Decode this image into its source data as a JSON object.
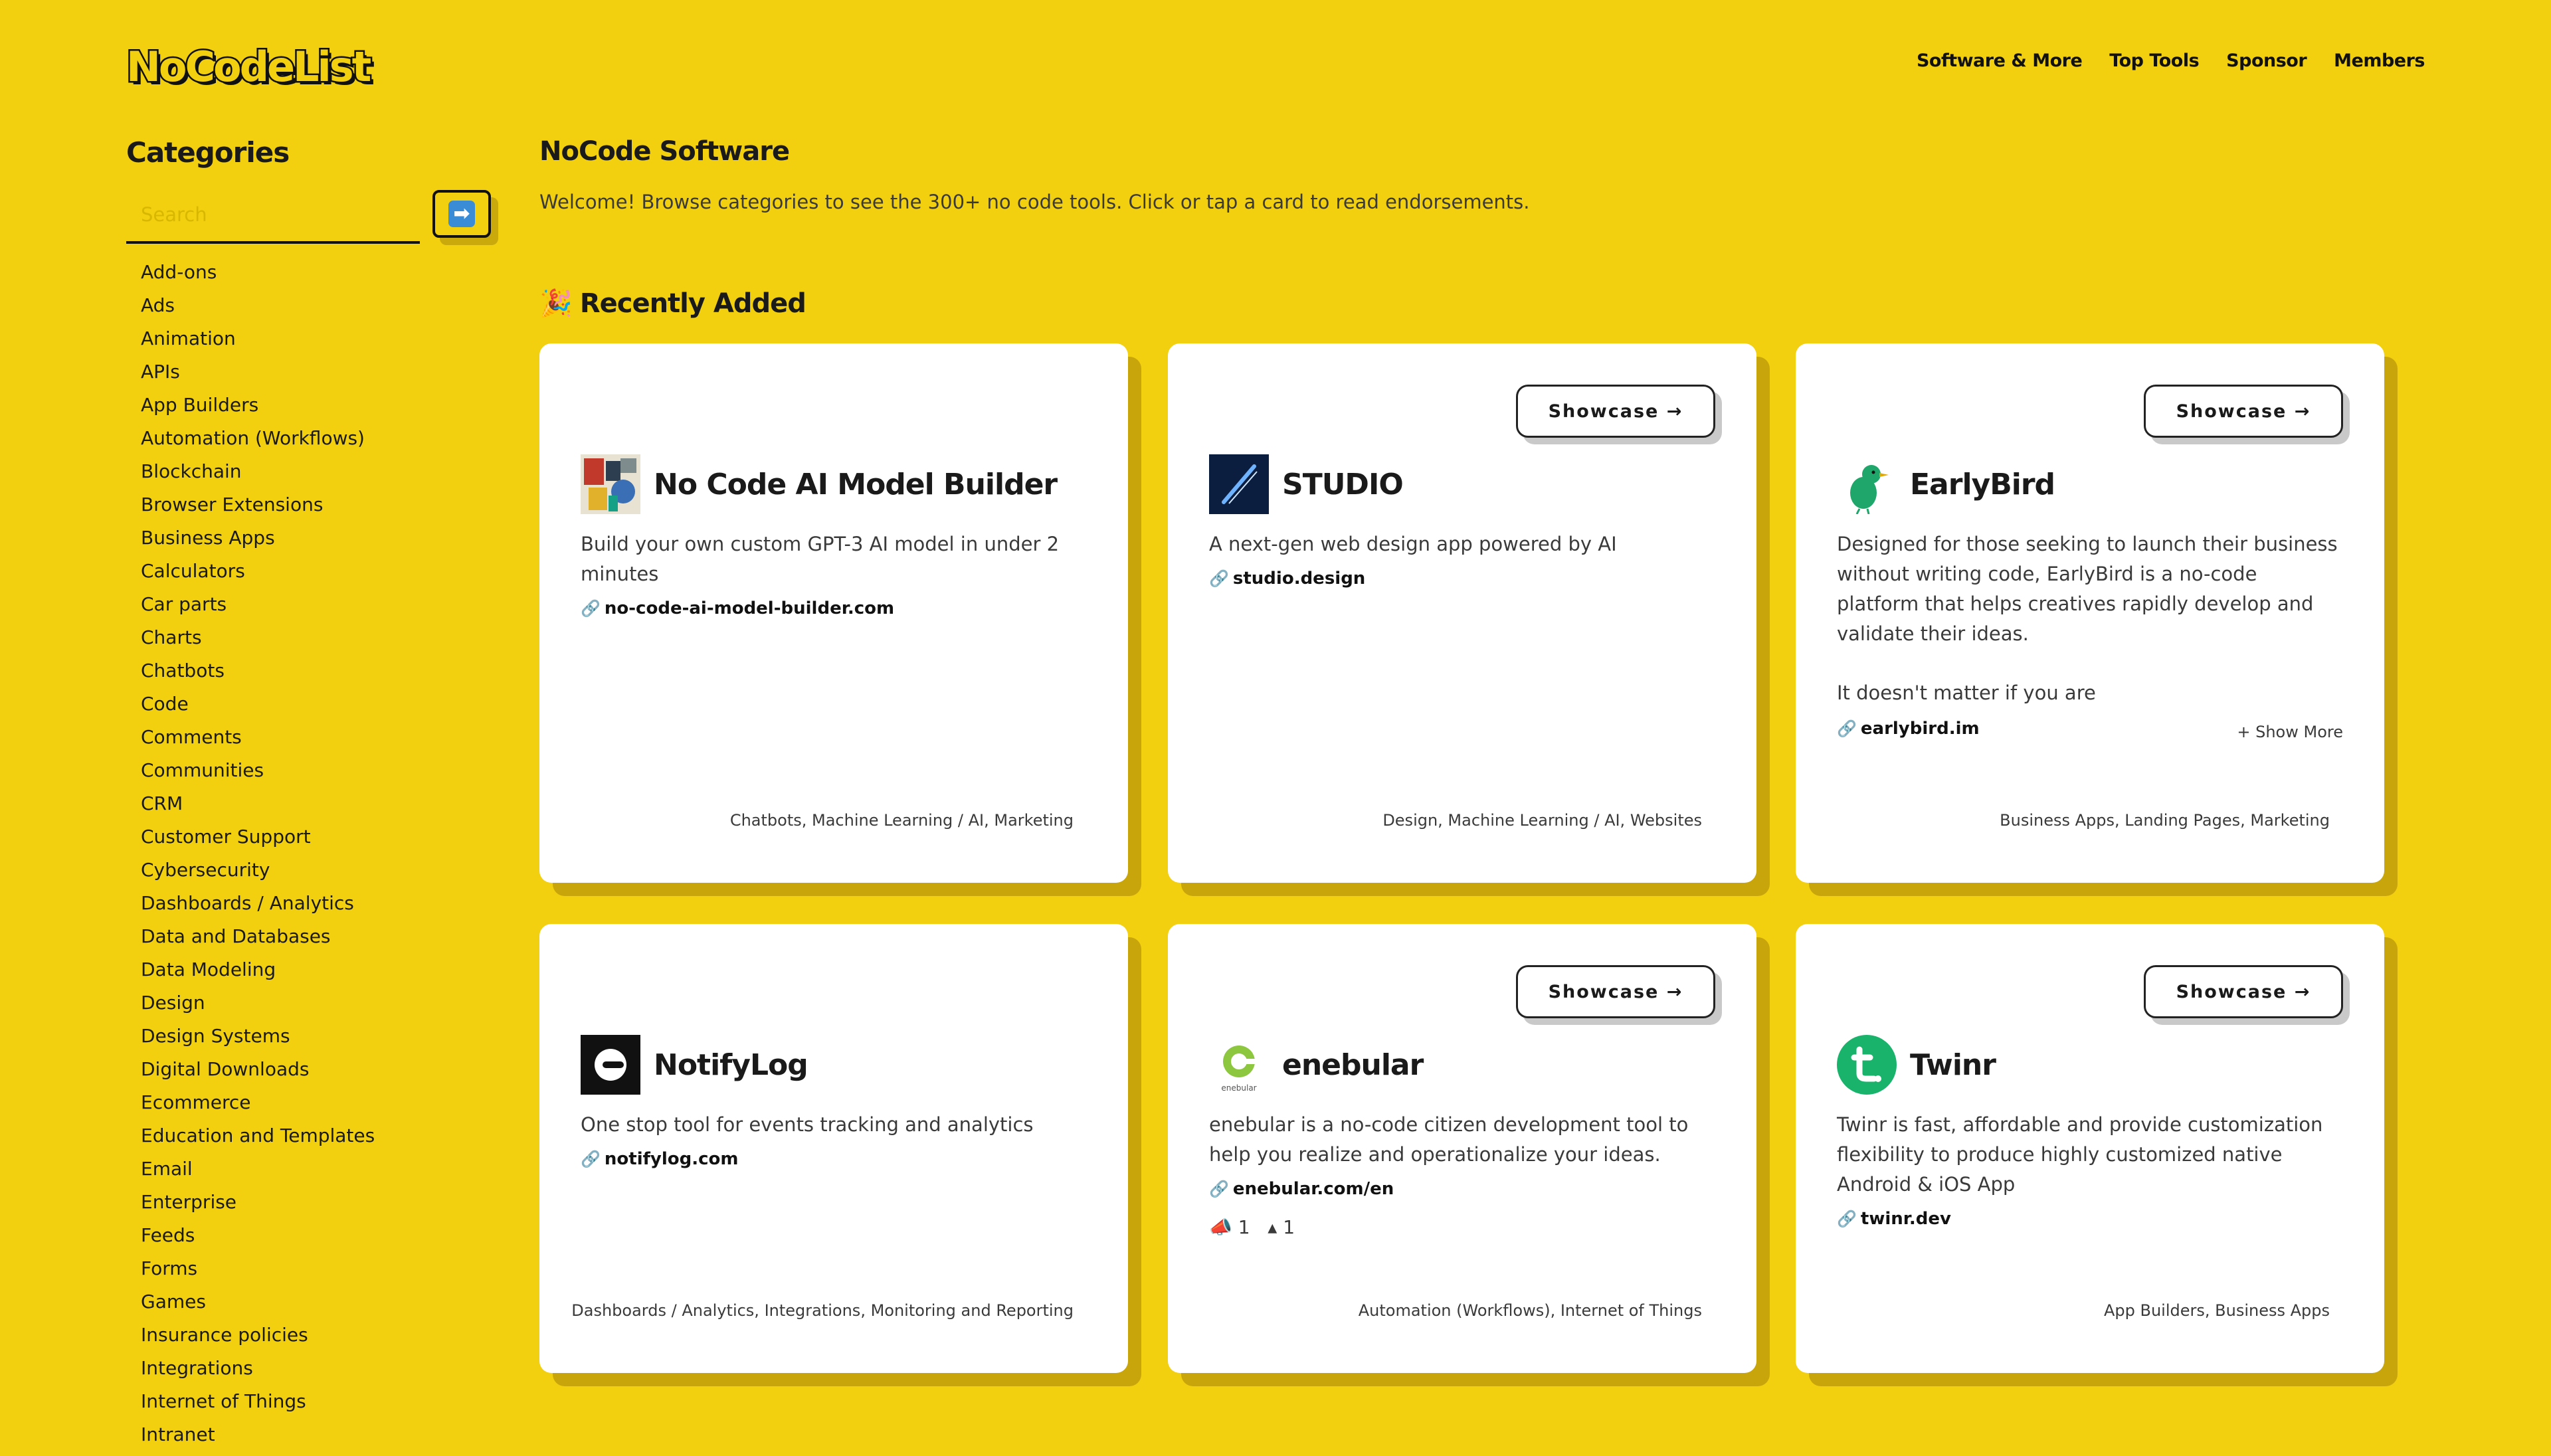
{
  "brand": {
    "logo_text": "NoCodeList"
  },
  "nav": [
    "Software & More",
    "Top Tools",
    "Sponsor",
    "Members"
  ],
  "sidebar": {
    "title": "Categories",
    "search_placeholder": "Search",
    "categories": [
      "Add-ons",
      "Ads",
      "Animation",
      "APIs",
      "App Builders",
      "Automation (Workflows)",
      "Blockchain",
      "Browser Extensions",
      "Business Apps",
      "Calculators",
      "Car parts",
      "Charts",
      "Chatbots",
      "Code",
      "Comments",
      "Communities",
      "CRM",
      "Customer Support",
      "Cybersecurity",
      "Dashboards / Analytics",
      "Data and Databases",
      "Data Modeling",
      "Design",
      "Design Systems",
      "Digital Downloads",
      "Ecommerce",
      "Education and Templates",
      "Email",
      "Enterprise",
      "Feeds",
      "Forms",
      "Games",
      "Insurance policies",
      "Integrations",
      "Internet of Things",
      "Intranet"
    ]
  },
  "main": {
    "title": "NoCode Software",
    "subtitle": "Welcome! Browse categories to see the 300+ no code tools. Click or tap a card to read endorsements.",
    "recent_icon": "🎉",
    "recent_title": "Recently Added",
    "showcase_label": "Showcase →",
    "link_icon": "🔗",
    "cards": [
      {
        "name": "No Code AI Model Builder",
        "desc": "Build your own custom GPT-3 AI model in under 2 minutes",
        "link": "no-code-ai-model-builder.com",
        "tags": "Chatbots, Machine Learning / AI, Marketing",
        "showcase": false,
        "logo_icon": "abstract-art-logo",
        "logo_color": "#3b6fb5"
      },
      {
        "name": "STUDIO",
        "desc": "A next-gen web design app powered by AI",
        "link": "studio.design",
        "tags": "Design, Machine Learning / AI, Websites",
        "showcase": true,
        "logo_icon": "studio-logo",
        "logo_color": "#0b1e3f"
      },
      {
        "name": "EarlyBird",
        "desc": "Designed for those seeking to launch their business without writing code, EarlyBird is a no-code platform that helps creatives rapidly develop and validate their ideas.",
        "desc2": "It doesn't matter if you are",
        "link": "earlybird.im",
        "tags": "Business Apps, Landing Pages, Marketing",
        "showcase": true,
        "show_more": "+ Show More",
        "logo_icon": "bird-logo",
        "logo_color": "#1fa66a"
      },
      {
        "name": "NotifyLog",
        "desc": "One stop tool for events tracking and analytics",
        "link": "notifylog.com",
        "tags": "Dashboards / Analytics, Integrations, Monitoring and Reporting",
        "showcase": false,
        "logo_icon": "notifylog-logo",
        "logo_color": "#111111"
      },
      {
        "name": "enebular",
        "desc": "enebular is a no-code citizen development tool to help you realize and operationalize your ideas.",
        "link": "enebular.com/en",
        "tags": "Automation (Workflows), Internet of Things",
        "showcase": true,
        "reactions": [
          "📣 1",
          "▴ 1"
        ],
        "logo_icon": "enebular-logo",
        "logo_color": "#8dc63f"
      },
      {
        "name": "Twinr",
        "desc": "Twinr is fast, affordable and provide customization flexibility to produce highly customized native Android & iOS App",
        "link": "twinr.dev",
        "tags": "App Builders, Business Apps",
        "showcase": true,
        "logo_icon": "twinr-logo",
        "logo_color": "#19b36b"
      }
    ]
  }
}
